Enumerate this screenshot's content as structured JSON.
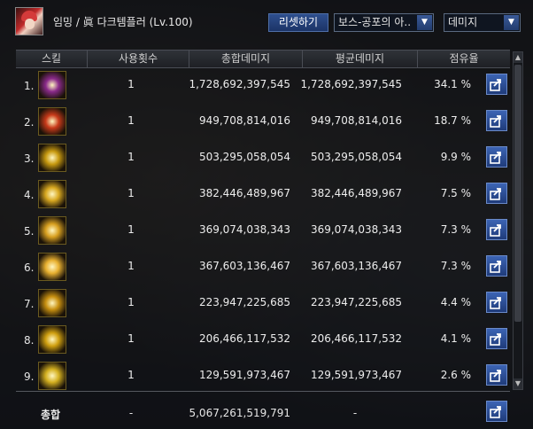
{
  "header": {
    "character_name": "임밍 / 眞 다크템플러 (Lv.100)",
    "reset_label": "리셋하기",
    "boss_select_value": "보스-공포의 아..",
    "metric_select_value": "데미지"
  },
  "table": {
    "columns": [
      "스킬",
      "사용횟수",
      "총합데미지",
      "평균데미지",
      "점유율"
    ],
    "rows": [
      {
        "rank": "1.",
        "icon": "skill-icon-1",
        "uses": "1",
        "total": "1,728,692,397,545",
        "avg": "1,728,692,397,545",
        "share": "34.1 %"
      },
      {
        "rank": "2.",
        "icon": "skill-icon-2",
        "uses": "1",
        "total": "949,708,814,016",
        "avg": "949,708,814,016",
        "share": "18.7 %"
      },
      {
        "rank": "3.",
        "icon": "skill-icon-3",
        "uses": "1",
        "total": "503,295,058,054",
        "avg": "503,295,058,054",
        "share": "9.9 %"
      },
      {
        "rank": "4.",
        "icon": "skill-icon-4",
        "uses": "1",
        "total": "382,446,489,967",
        "avg": "382,446,489,967",
        "share": "7.5 %"
      },
      {
        "rank": "5.",
        "icon": "skill-icon-5",
        "uses": "1",
        "total": "369,074,038,343",
        "avg": "369,074,038,343",
        "share": "7.3 %"
      },
      {
        "rank": "6.",
        "icon": "skill-icon-6",
        "uses": "1",
        "total": "367,603,136,467",
        "avg": "367,603,136,467",
        "share": "7.3 %"
      },
      {
        "rank": "7.",
        "icon": "skill-icon-7",
        "uses": "1",
        "total": "223,947,225,685",
        "avg": "223,947,225,685",
        "share": "4.4 %"
      },
      {
        "rank": "8.",
        "icon": "skill-icon-8",
        "uses": "1",
        "total": "206,466,117,532",
        "avg": "206,466,117,532",
        "share": "4.1 %"
      },
      {
        "rank": "9.",
        "icon": "skill-icon-9",
        "uses": "1",
        "total": "129,591,973,467",
        "avg": "129,591,973,467",
        "share": "2.6 %"
      }
    ]
  },
  "summary": {
    "label": "총합",
    "uses": "-",
    "total": "5,067,261,519,791",
    "avg": "-"
  },
  "colors": {
    "accent": "#2e4f8e",
    "icon_tint": [
      "#8a2a8a",
      "#c83a1a",
      "#c89a10",
      "#d8a820",
      "#d8a020",
      "#e8b030",
      "#c89010",
      "#d0a010",
      "#d4b020"
    ]
  }
}
